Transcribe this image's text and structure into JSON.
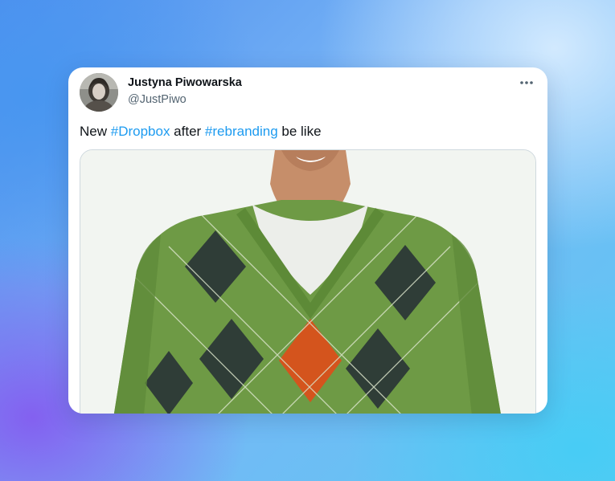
{
  "tweet": {
    "author_name": "Justyna Piwowarska",
    "author_handle": "@JustPiwo",
    "text_before": "New ",
    "hashtag_1": "#Dropbox",
    "text_middle": " after ",
    "hashtag_2": "#rebranding",
    "text_after": " be like"
  },
  "icons": {
    "more": "more-horizontal-icon",
    "avatar": "user-avatar",
    "media": "argyle-sweater-photo"
  },
  "colors": {
    "hashtag": "#1d9bf0",
    "text": "#0f1419",
    "secondary_text": "#536471",
    "sweater_green": "#6e9a45",
    "diamond_dark": "#2f3d37",
    "diamond_orange": "#d4541d"
  }
}
